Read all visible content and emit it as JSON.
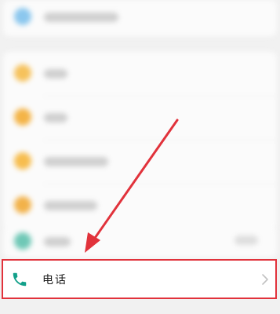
{
  "settings_list": {
    "highlighted_item": {
      "label": "电话",
      "icon": "phone-icon",
      "icon_color": "#13a08a"
    }
  },
  "colors": {
    "highlight_border": "#e1323b",
    "arrow": "#e1323b"
  }
}
